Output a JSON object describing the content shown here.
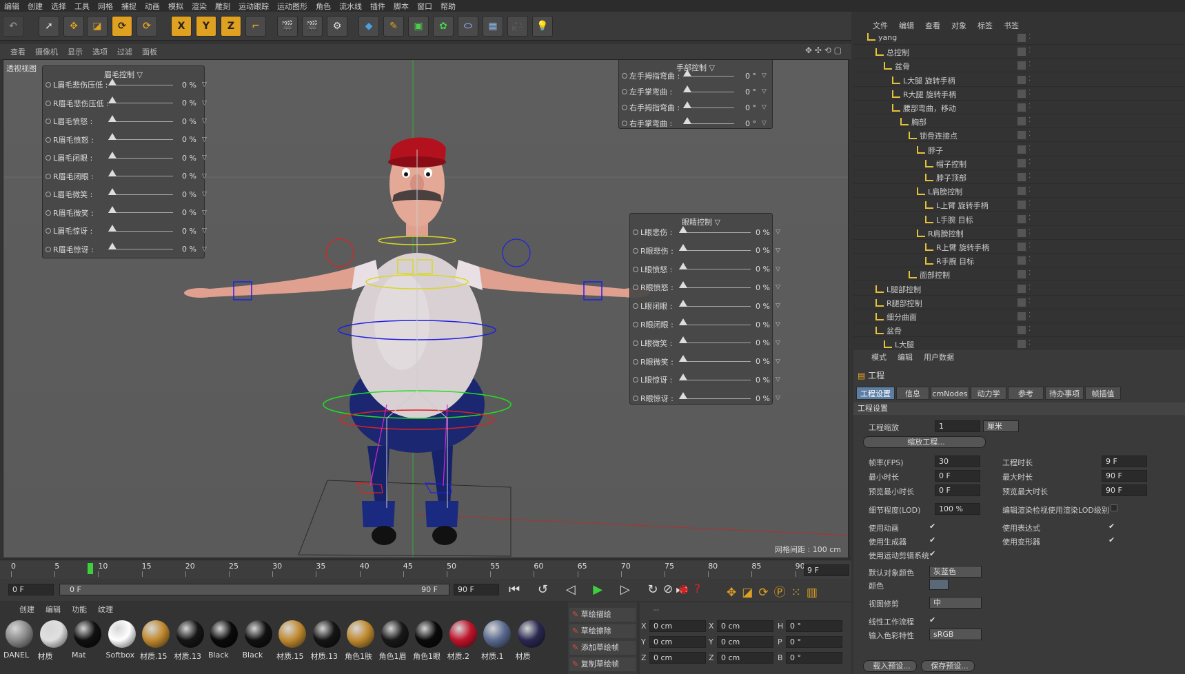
{
  "menubar": [
    "编辑",
    "创建",
    "选择",
    "工具",
    "网格",
    "捕捉",
    "动画",
    "模拟",
    "渲染",
    "雕刻",
    "运动跟踪",
    "运动图形",
    "角色",
    "流水线",
    "插件",
    "脚本",
    "窗口",
    "帮助"
  ],
  "toolbar": {
    "x_label": "X",
    "y_label": "Y",
    "z_label": "Z"
  },
  "viewport_menu": [
    "查看",
    "摄像机",
    "显示",
    "选项",
    "过滤",
    "面板"
  ],
  "viewport": {
    "label": "透视视图",
    "grid_spacing": "网格间距 : 100 cm",
    "brow_panel": {
      "title": "眉毛控制",
      "rows": [
        {
          "label": "L眉毛悲伤压低 :",
          "value": "0 %"
        },
        {
          "label": "R眉毛悲伤压低 :",
          "value": "0 %"
        },
        {
          "label": "L眉毛愤怒 :",
          "value": "0 %"
        },
        {
          "label": "R眉毛愤怒 :",
          "value": "0 %"
        },
        {
          "label": "L眉毛闭眼 :",
          "value": "0 %"
        },
        {
          "label": "R眉毛闭眼 :",
          "value": "0 %"
        },
        {
          "label": "L眉毛微笑 :",
          "value": "0 %"
        },
        {
          "label": "R眉毛微笑 :",
          "value": "0 %"
        },
        {
          "label": "L眉毛惊讶 :",
          "value": "0 %"
        },
        {
          "label": "R眉毛惊讶 :",
          "value": "0 %"
        }
      ]
    },
    "hand_panel": {
      "title": "手部控制",
      "rows": [
        {
          "label": "左手拇指弯曲 :",
          "value": "0 °"
        },
        {
          "label": "左手掌弯曲 :",
          "value": "0 °"
        },
        {
          "label": "右手拇指弯曲 :",
          "value": "0 °"
        },
        {
          "label": "右手掌弯曲 :",
          "value": "0 °"
        }
      ]
    },
    "eye_panel": {
      "title": "眼睛控制",
      "rows": [
        {
          "label": "L眼悲伤 :",
          "value": "0 %"
        },
        {
          "label": "R眼悲伤 :",
          "value": "0 %"
        },
        {
          "label": "L眼愤怒 :",
          "value": "0 %"
        },
        {
          "label": "R眼愤怒 :",
          "value": "0 %"
        },
        {
          "label": "L眼闭眼 :",
          "value": "0 %"
        },
        {
          "label": "R眼闭眼 :",
          "value": "0 %"
        },
        {
          "label": "L眼微笑 :",
          "value": "0 %"
        },
        {
          "label": "R眼微笑 :",
          "value": "0 %"
        },
        {
          "label": "L眼惊讶 :",
          "value": "0 %"
        },
        {
          "label": "R眼惊讶 :",
          "value": "0 %"
        }
      ]
    }
  },
  "object_manager": {
    "menu": [
      "文件",
      "编辑",
      "查看",
      "对象",
      "标签",
      "书签"
    ],
    "items": [
      {
        "name": "yang",
        "indent": 0
      },
      {
        "name": "总控制",
        "indent": 1
      },
      {
        "name": "盆骨",
        "indent": 2
      },
      {
        "name": "L大腿 旋转手柄",
        "indent": 3
      },
      {
        "name": "R大腿 旋转手柄",
        "indent": 3
      },
      {
        "name": "腰部弯曲，移动",
        "indent": 3
      },
      {
        "name": "胸部",
        "indent": 4
      },
      {
        "name": "锁骨连接点",
        "indent": 5
      },
      {
        "name": "脖子",
        "indent": 6
      },
      {
        "name": "帽子控制",
        "indent": 7
      },
      {
        "name": "脖子顶部",
        "indent": 7
      },
      {
        "name": "L肩膀控制",
        "indent": 6
      },
      {
        "name": "L上臂 旋转手柄",
        "indent": 7
      },
      {
        "name": "L手腕 目标",
        "indent": 7
      },
      {
        "name": "R肩膀控制",
        "indent": 6
      },
      {
        "name": "R上臂 旋转手柄",
        "indent": 7
      },
      {
        "name": "R手腕 目标",
        "indent": 7
      },
      {
        "name": "面部控制",
        "indent": 5
      },
      {
        "name": "L腿部控制",
        "indent": 1
      },
      {
        "name": "R腿部控制",
        "indent": 1
      },
      {
        "name": "细分曲面",
        "indent": 1
      },
      {
        "name": "盆骨",
        "indent": 1
      },
      {
        "name": "L大腿",
        "indent": 2
      }
    ]
  },
  "attributes": {
    "menu": [
      "模式",
      "编辑",
      "用户数据"
    ],
    "heading": "工程",
    "tabs": [
      "工程设置",
      "信息",
      "cmNodes",
      "动力学",
      "参考",
      "待办事项",
      "帧插值"
    ],
    "section": "工程设置",
    "scale_label": "工程缩放",
    "scale_value": "1",
    "scale_unit": "厘米",
    "scale_button": "缩放工程...",
    "fps_label": "帧率(FPS)",
    "fps_value": "30",
    "duration_label": "工程时长",
    "duration_value": "9 F",
    "min_label": "最小时长",
    "min_value": "0 F",
    "max_label": "最大时长",
    "max_value": "90 F",
    "pmin_label": "预览最小时长",
    "pmin_value": "0 F",
    "pmax_label": "预览最大时长",
    "pmax_value": "90 F",
    "lod_label": "细节程度(LOD)",
    "lod_value": "100 %",
    "lod_render_label": "编辑渲染检视使用渲染LOD级别",
    "anim_label": "使用动画",
    "expr_label": "使用表达式",
    "gen_label": "使用生成器",
    "deform_label": "使用变形器",
    "motion_label": "使用运动剪辑系统",
    "objcolor_label": "默认对象颜色",
    "objcolor_value": "灰蓝色",
    "color_label": "颜色",
    "clip_label": "视图修剪",
    "clip_value": "中",
    "linear_label": "线性工作流程",
    "colorprof_label": "输入色彩特性",
    "colorprof_value": "sRGB",
    "load_preset": "载入预设...",
    "save_preset": "保存预设..."
  },
  "timeline": {
    "ticks": [
      "0",
      "5",
      "10",
      "15",
      "20",
      "25",
      "30",
      "35",
      "40",
      "45",
      "50",
      "55",
      "60",
      "65",
      "70",
      "75",
      "80",
      "85",
      "90"
    ],
    "current": "90",
    "current_frame_box": "9 F"
  },
  "transport": {
    "start": "0 F",
    "range_start": "0 F",
    "range_end": "90 F",
    "end": "90 F"
  },
  "materials": {
    "menu": [
      "创建",
      "编辑",
      "功能",
      "纹理"
    ],
    "items": [
      {
        "name": "DANEL",
        "color": "#8a8a8a"
      },
      {
        "name": "材质",
        "color": "#e0e0e0"
      },
      {
        "name": "Mat",
        "color": "#101010"
      },
      {
        "name": "Softbox",
        "color": "#ffffff"
      },
      {
        "name": "材质.15",
        "color": "#c08a30"
      },
      {
        "name": "材质.13",
        "color": "#151515"
      },
      {
        "name": "Black",
        "color": "#0a0a0a"
      },
      {
        "name": "Black",
        "color": "#111111"
      },
      {
        "name": "材质.15",
        "color": "#c08a30"
      },
      {
        "name": "材质.13",
        "color": "#151515"
      },
      {
        "name": "角色1肤",
        "color": "#c08a30"
      },
      {
        "name": "角色1眉",
        "color": "#181818"
      },
      {
        "name": "角色1眼",
        "color": "#0a0a0a"
      },
      {
        "name": "材质.2",
        "color": "#c0142a"
      },
      {
        "name": "材质.1",
        "color": "#5a6a90"
      },
      {
        "name": "材质",
        "color": "#2a2850"
      }
    ]
  },
  "sculpt": [
    "草绘描绘",
    "草绘擦除",
    "添加草绘帧",
    "复制草绘帧"
  ],
  "coordinates": {
    "rows": [
      {
        "a": "X",
        "av": "0 cm",
        "b": "X",
        "bv": "0 cm",
        "c": "H",
        "cv": "0 °"
      },
      {
        "a": "Y",
        "av": "0 cm",
        "b": "Y",
        "bv": "0 cm",
        "c": "P",
        "cv": "0 °"
      },
      {
        "a": "Z",
        "av": "0 cm",
        "b": "Z",
        "bv": "0 cm",
        "c": "B",
        "cv": "0 °"
      }
    ],
    "header": "--"
  },
  "colors": {
    "accent": "#5c7ea3",
    "folder": "#e6c23a",
    "play": "#3ecf3e"
  }
}
